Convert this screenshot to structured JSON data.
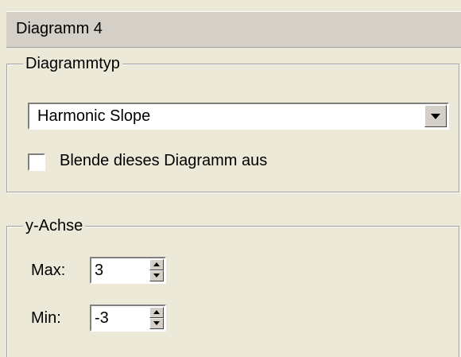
{
  "panel": {
    "title": "Diagramm 4"
  },
  "diagram_type_group": {
    "legend": "Diagrammtyp",
    "selected_type": "Harmonic Slope",
    "hide_checkbox": {
      "label": "Blende dieses Diagramm aus",
      "checked": false
    }
  },
  "y_axis_group": {
    "legend": "y-Achse",
    "max": {
      "label": "Max:",
      "value": "3"
    },
    "min": {
      "label": "Min:",
      "value": "-3"
    }
  },
  "colors": {
    "background": "#ece9d8",
    "title_bar": "#d4d0c8",
    "input_background": "#ffffff"
  }
}
